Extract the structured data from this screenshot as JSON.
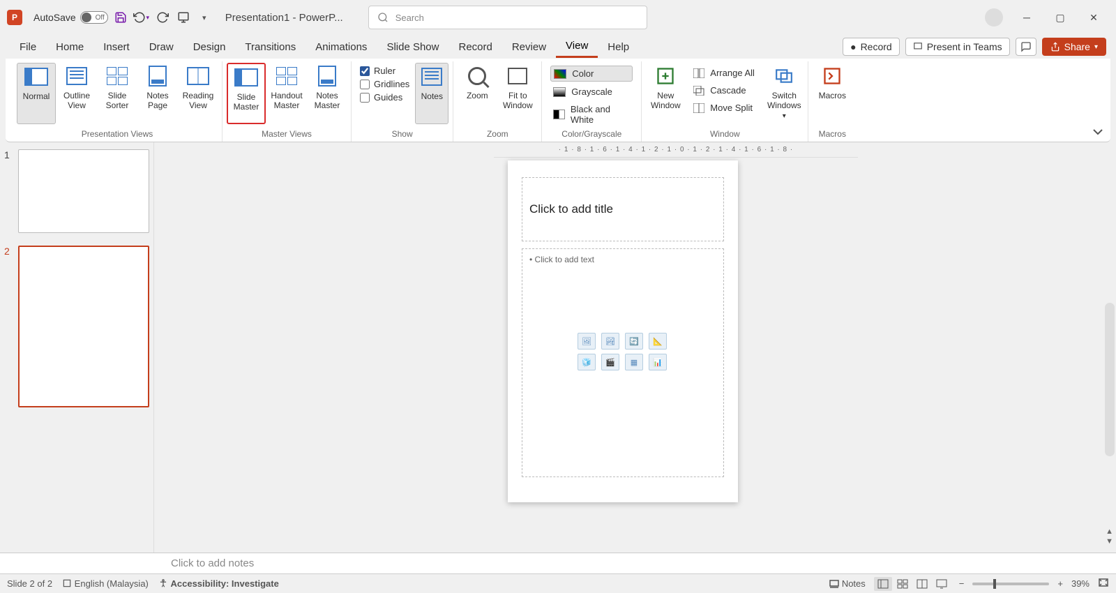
{
  "titlebar": {
    "autosave_label": "AutoSave",
    "autosave_state": "Off",
    "document_title": "Presentation1  -  PowerP...",
    "search_placeholder": "Search"
  },
  "menus": {
    "file": "File",
    "home": "Home",
    "insert": "Insert",
    "draw": "Draw",
    "design": "Design",
    "transitions": "Transitions",
    "animations": "Animations",
    "slideshow": "Slide Show",
    "record": "Record",
    "review": "Review",
    "view": "View",
    "help": "Help"
  },
  "menu_right": {
    "record": "Record",
    "present": "Present in Teams",
    "share": "Share"
  },
  "ribbon": {
    "groups": {
      "presentation_views": {
        "label": "Presentation Views",
        "normal": "Normal",
        "outline": "Outline View",
        "sorter": "Slide Sorter",
        "notespage": "Notes Page",
        "reading": "Reading View"
      },
      "master_views": {
        "label": "Master Views",
        "slide": "Slide Master",
        "handout": "Handout Master",
        "notes": "Notes Master"
      },
      "show": {
        "label": "Show",
        "ruler": "Ruler",
        "gridlines": "Gridlines",
        "guides": "Guides",
        "notes": "Notes"
      },
      "zoom": {
        "label": "Zoom",
        "zoom": "Zoom",
        "fit": "Fit to Window"
      },
      "color": {
        "label": "Color/Grayscale",
        "color": "Color",
        "grayscale": "Grayscale",
        "bw": "Black and White"
      },
      "window": {
        "label": "Window",
        "new": "New Window",
        "arrange": "Arrange All",
        "cascade": "Cascade",
        "movesplit": "Move Split",
        "switch": "Switch Windows"
      },
      "macros": {
        "label": "Macros",
        "macros": "Macros"
      }
    }
  },
  "thumbnails": {
    "items": [
      {
        "num": "1",
        "selected": false
      },
      {
        "num": "2",
        "selected": true
      }
    ]
  },
  "slide": {
    "title_placeholder": "Click to add title",
    "body_placeholder": "Click to add text"
  },
  "ruler": {
    "horizontal": "· 1 · 8 · 1 · 6 · 1 · 4 · 1 · 2 · 1 · 0 · 1 · 2 · 1 · 4 · 1 · 6 · 1 · 8 ·"
  },
  "notes": {
    "placeholder": "Click to add notes"
  },
  "status": {
    "slide_count": "Slide 2 of 2",
    "language": "English (Malaysia)",
    "accessibility": "Accessibility: Investigate",
    "notes_btn": "Notes",
    "zoom_pct": "39%"
  }
}
